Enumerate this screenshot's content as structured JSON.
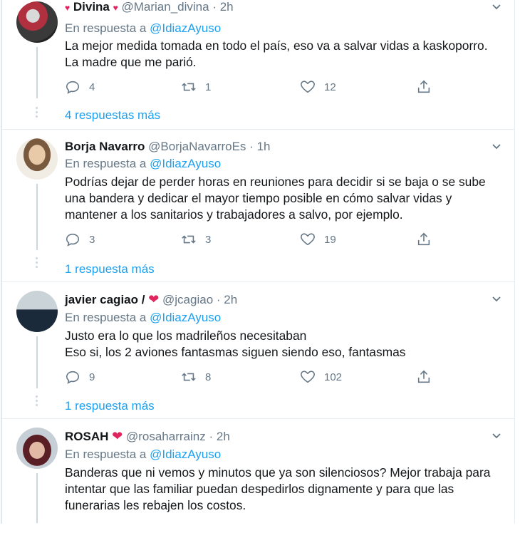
{
  "tweets": [
    {
      "name": "Divina",
      "handle": "@Marian_divina",
      "time": "2h",
      "reply_prefix": "En respuesta a",
      "reply_to": "@IdiazAyuso",
      "lines": [
        "La mejor medida tomada en todo el país, eso va a salvar vidas a kaskoporro.",
        "La madre que me parió."
      ],
      "replies": "4",
      "retweets": "1",
      "likes": "12",
      "more": "4 respuestas más"
    },
    {
      "name": "Borja Navarro",
      "handle": "@BorjaNavarroEs",
      "time": "1h",
      "reply_prefix": "En respuesta a",
      "reply_to": "@IdiazAyuso",
      "lines": [
        "Podrías dejar de perder horas en reuniones para decidir si se baja o se sube",
        "una bandera y dedicar el mayor tiempo posible en cómo salvar vidas y",
        "mantener a los sanitarios y trabajadores a salvo, por ejemplo."
      ],
      "replies": "3",
      "retweets": "3",
      "likes": "19",
      "more": "1 respuesta más"
    },
    {
      "name": "javier cagiao /",
      "handle": "@jcagiao",
      "time": "2h",
      "reply_prefix": "En respuesta a",
      "reply_to": "@IdiazAyuso",
      "lines": [
        "Justo era lo que los madrileños necesitaban",
        "Eso si, los 2 aviones fantasmas siguen siendo eso, fantasmas"
      ],
      "replies": "9",
      "retweets": "8",
      "likes": "102",
      "more": "1 respuesta más"
    },
    {
      "name": "ROSAH",
      "handle": "@rosaharrainz",
      "time": "2h",
      "reply_prefix": "En respuesta a",
      "reply_to": "@IdiazAyuso",
      "lines": [
        "Banderas que ni vemos y minutos que ya son silenciosos? Mejor trabaja para",
        "intentar que las familiar puedan despedirlos dignamente y para que las",
        "funerarias les rebajen los costos."
      ]
    }
  ],
  "separator": "·",
  "colors": {
    "accent": "#1da1f2",
    "muted": "#657786",
    "heart": "#e0245e",
    "border": "#e6ecf0"
  },
  "icons": [
    "reply-icon",
    "retweet-icon",
    "like-icon",
    "share-icon",
    "chevron-down-icon",
    "heart-emoji-icon"
  ]
}
